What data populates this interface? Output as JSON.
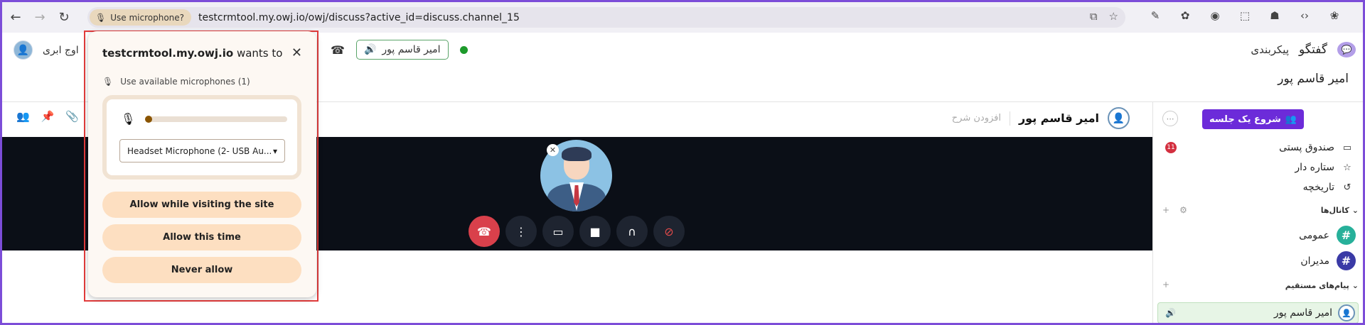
{
  "browser": {
    "mic_chip_label": "Use microphone?",
    "url": "testcrmtool.my.owj.io/owj/discuss?active_id=discuss.channel_15"
  },
  "header": {
    "app_name": "گفتگو",
    "menu_config": "پیکربندی",
    "company": "اوج ابری",
    "participant": "امیر قاسم پور"
  },
  "page_title": "امیر قاسم پور",
  "thread": {
    "name": "امیر قاسم پور",
    "description_placeholder": "افزودن شرح"
  },
  "sidebar": {
    "start_meeting": "شروع یک جلسه",
    "inbox": "صندوق پستی",
    "inbox_count": "11",
    "starred": "ستاره دار",
    "history": "تاریخچه",
    "channels_header": "کانال‌ها",
    "channels": [
      {
        "name": "عمومی",
        "color": "#27b09a"
      },
      {
        "name": "مدیران",
        "color": "#3a3aa6"
      }
    ],
    "dm_header": "پیام‌های مستقیم",
    "dm_name": "امیر قاسم پور"
  },
  "popup": {
    "site": "testcrmtool.my.owj.io",
    "wants_to": "wants to",
    "subtitle": "Use available microphones (1)",
    "mic_level": 0.03,
    "selected_mic": "Headset Microphone (2- USB Au...",
    "allow_visit": "Allow while visiting the site",
    "allow_once": "Allow this time",
    "never": "Never allow"
  },
  "colors": {
    "frame": "#7c4dd8",
    "accent": "#6c2bd9",
    "hangup": "#d9404b",
    "popup_button": "#fddfc1"
  }
}
